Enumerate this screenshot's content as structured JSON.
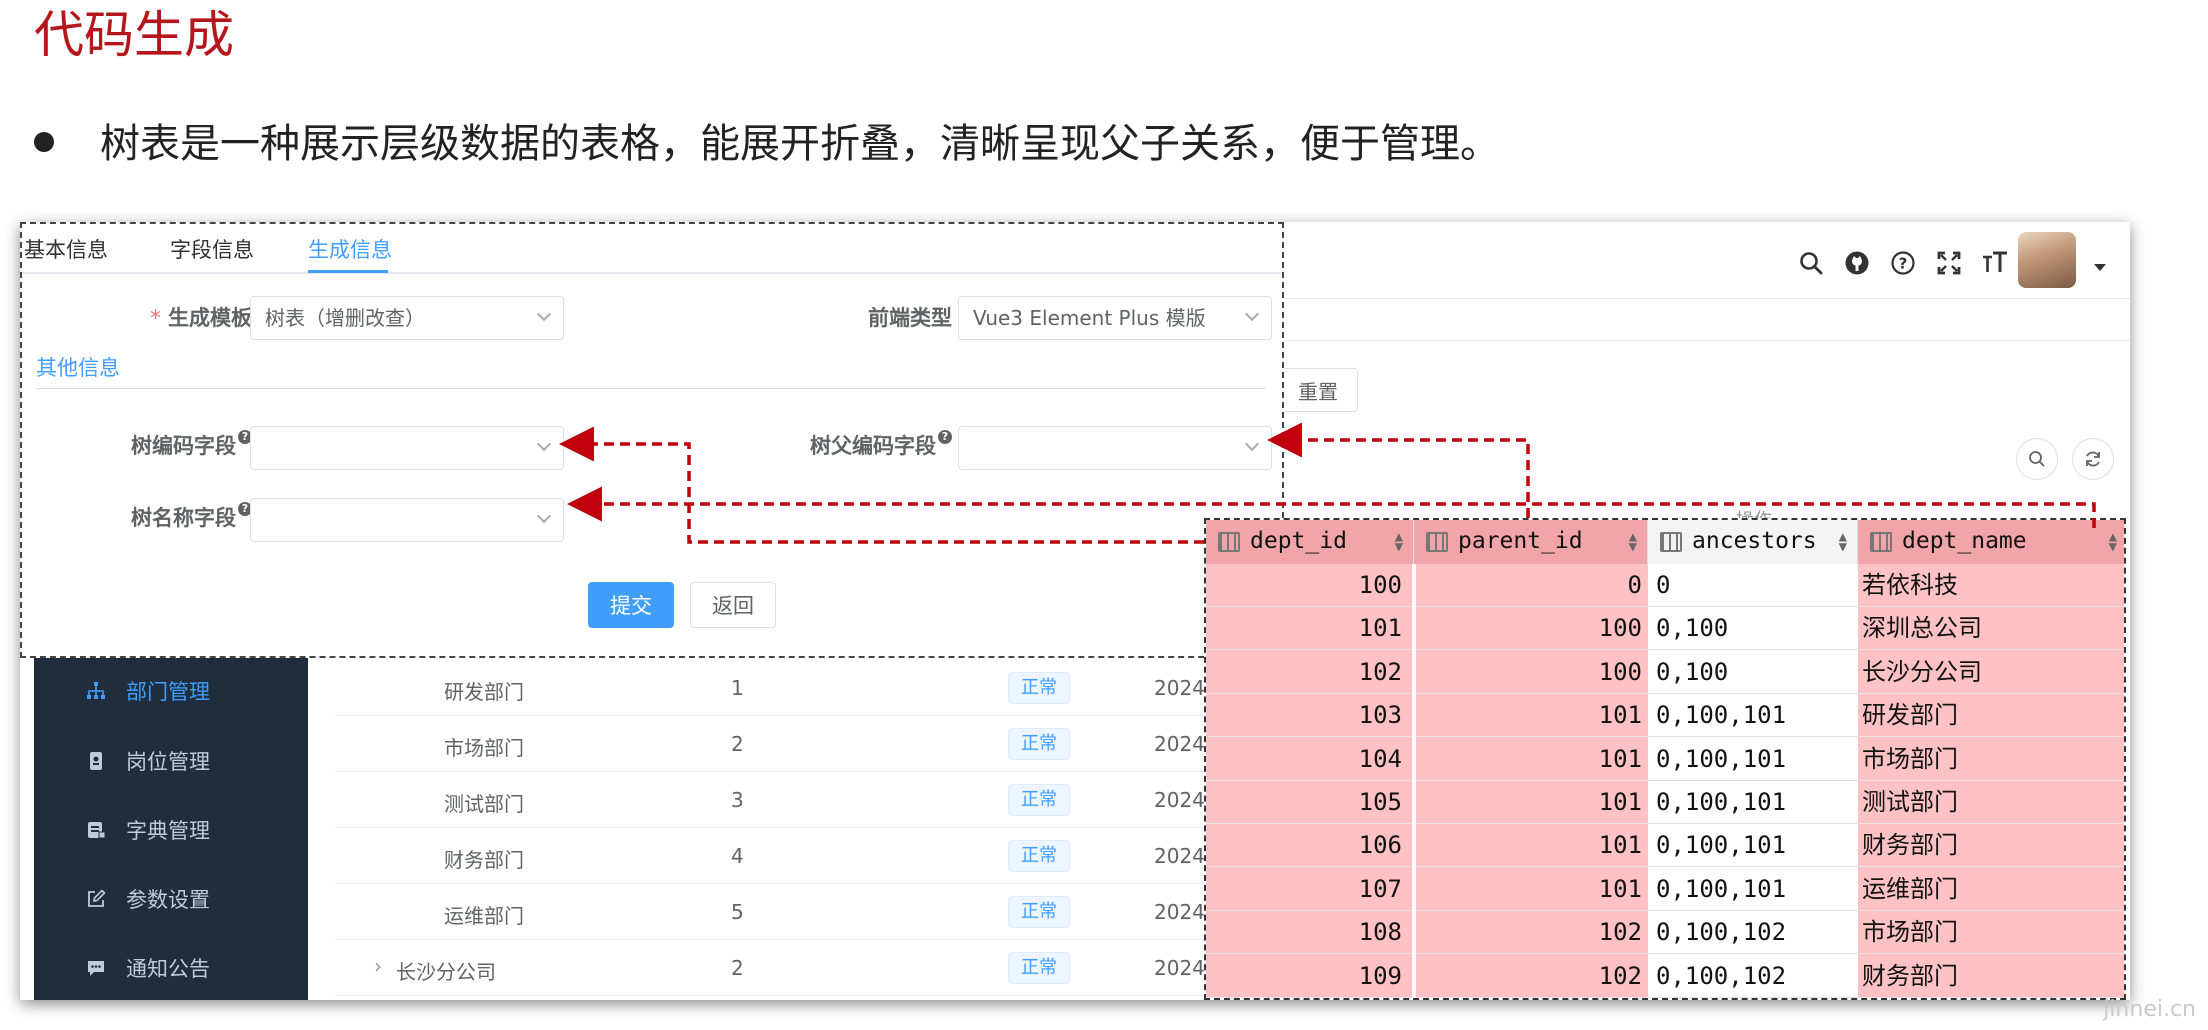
{
  "slide": {
    "title": "代码生成",
    "bullet": "树表是一种展示层级数据的表格，能展开折叠，清晰呈现父子关系，便于管理。",
    "watermark": "jinnei.cn"
  },
  "colors": {
    "title": "#b5161b",
    "accent": "#409eff",
    "sidebar_bg": "#1f2d3d",
    "highlight": "#ffc2c4",
    "arrow": "#c0000b"
  },
  "header_icons": [
    "search-icon",
    "github-icon",
    "help-icon",
    "fullscreen-icon",
    "font-size-icon"
  ],
  "toolbar": {
    "reset_label": "重置",
    "operation_header": "操作"
  },
  "dialog": {
    "tabs": [
      {
        "label": "基本信息",
        "active": false
      },
      {
        "label": "字段信息",
        "active": false
      },
      {
        "label": "生成信息",
        "active": true
      }
    ],
    "fields": {
      "template_label": "生成模板",
      "template_value": "树表（增删改查）",
      "frontend_label": "前端类型",
      "frontend_value": "Vue3 Element Plus 模版",
      "section_title": "其他信息",
      "tree_code_label": "树编码字段",
      "tree_parent_label": "树父编码字段",
      "tree_name_label": "树名称字段",
      "required_mark": "*",
      "help_mark": "?"
    },
    "buttons": {
      "submit": "提交",
      "back": "返回"
    }
  },
  "sidebar": {
    "items": [
      {
        "label": "部门管理",
        "icon": "org-tree-icon",
        "active": true
      },
      {
        "label": "岗位管理",
        "icon": "post-icon",
        "active": false
      },
      {
        "label": "字典管理",
        "icon": "dictionary-icon",
        "active": false
      },
      {
        "label": "参数设置",
        "icon": "edit-icon",
        "active": false
      },
      {
        "label": "通知公告",
        "icon": "message-icon",
        "active": false
      }
    ]
  },
  "dept_table": {
    "rows": [
      {
        "name": "研发部门",
        "order": "1",
        "status": "正常",
        "time": "2024"
      },
      {
        "name": "市场部门",
        "order": "2",
        "status": "正常",
        "time": "2024"
      },
      {
        "name": "测试部门",
        "order": "3",
        "status": "正常",
        "time": "2024"
      },
      {
        "name": "财务部门",
        "order": "4",
        "status": "正常",
        "time": "2024"
      },
      {
        "name": "运维部门",
        "order": "5",
        "status": "正常",
        "time": "2024"
      },
      {
        "name": "长沙分公司",
        "order": "2",
        "status": "正常",
        "time": "2024",
        "expandable": true
      }
    ]
  },
  "db_table": {
    "columns": [
      "dept_id",
      "parent_id",
      "ancestors",
      "dept_name"
    ],
    "rows": [
      [
        "100",
        "0",
        "0",
        "若依科技"
      ],
      [
        "101",
        "100",
        "0,100",
        "深圳总公司"
      ],
      [
        "102",
        "100",
        "0,100",
        "长沙分公司"
      ],
      [
        "103",
        "101",
        "0,100,101",
        "研发部门"
      ],
      [
        "104",
        "101",
        "0,100,101",
        "市场部门"
      ],
      [
        "105",
        "101",
        "0,100,101",
        "测试部门"
      ],
      [
        "106",
        "101",
        "0,100,101",
        "财务部门"
      ],
      [
        "107",
        "101",
        "0,100,101",
        "运维部门"
      ],
      [
        "108",
        "102",
        "0,100,102",
        "市场部门"
      ],
      [
        "109",
        "102",
        "0,100,102",
        "财务部门"
      ]
    ]
  }
}
